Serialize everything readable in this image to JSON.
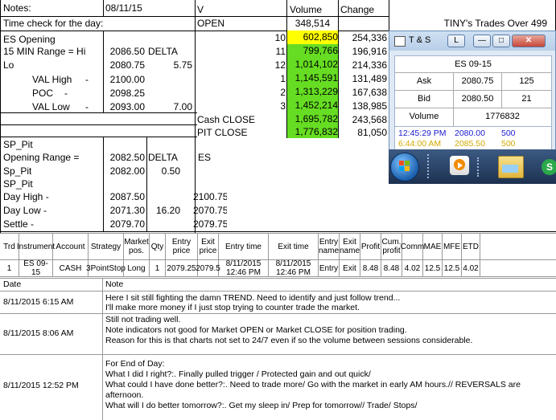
{
  "sheet": {
    "notes_label": "Notes:",
    "date": "08/11/15",
    "time_check": "Time check for the day:",
    "tinys": "TINY's Trades Over 499",
    "es_opening": "ES Opening",
    "range_label": "15 MIN Range = Hi",
    "range_hi": "2086.50",
    "delta_label": "DELTA",
    "lo_label": "Lo",
    "lo_value": "2080.75",
    "delta_value": "5.75",
    "val_high_label": "VAL High",
    "val_high_dash": "-",
    "val_high": "2100.00",
    "poc_label": "POC",
    "poc_dash": "-",
    "poc": "2098.25",
    "val_low_label": "VAL Low",
    "val_low_dash": "-",
    "val_low": "2093.00",
    "val_low_delta": "7.00",
    "sp_pit": "SP_Pit",
    "opening_range_label": "Opening Range =",
    "opening_range": "2082.50",
    "delta2_label": "DELTA",
    "es_label": "ES",
    "sp_pit2_label": "Sp_Pit",
    "sp_pit2_value": "2082.00",
    "sp_pit2_delta": "0.50",
    "sp_pit3": "SP_Pit",
    "day_high_label": "Day High -",
    "day_high": "2087.50",
    "day_high_es": "2100.75",
    "day_low_label": "Day Low -",
    "day_low": "2071.30",
    "day_low_delta": "16.20",
    "day_low_es": "2070.75",
    "settle_label": "Settle -",
    "settle": "2079.70",
    "settle_es": "2079.75"
  },
  "volume_table": {
    "headers": [
      "V",
      "Volume",
      "Change"
    ],
    "open_label": "OPEN",
    "open_volume": "348,514",
    "rows": [
      {
        "label": "10",
        "volume": "602,850",
        "change": "254,336"
      },
      {
        "label": "11",
        "volume": "799,766",
        "change": "196,916"
      },
      {
        "label": "12",
        "volume": "1,014,102",
        "change": "214,336"
      },
      {
        "label": "1",
        "volume": "1,145,591",
        "change": "131,489"
      },
      {
        "label": "2",
        "volume": "1,313,229",
        "change": "167,638"
      },
      {
        "label": "3",
        "volume": "1,452,214",
        "change": "138,985"
      },
      {
        "label": "Cash CLOSE",
        "volume": "1,695,782",
        "change": "243,568"
      },
      {
        "label": "PIT CLOSE",
        "volume": "1,776,832",
        "change": "81,050"
      }
    ]
  },
  "ts_window": {
    "title": "T & S",
    "l_btn": "L",
    "symbol": "ES 09-15",
    "ask_label": "Ask",
    "ask_price": "2080.75",
    "ask_size": "125",
    "bid_label": "Bid",
    "bid_price": "2080.50",
    "bid_size": "21",
    "volume_label": "Volume",
    "volume": "1776832",
    "ticks": [
      {
        "time": "12:45:29 PM",
        "price": "2080.00",
        "size": "500"
      },
      {
        "time": "6:44:00 AM",
        "price": "2085.50",
        "size": "500"
      }
    ]
  },
  "trade_table": {
    "headers": [
      "Trd",
      "Instrument",
      "Account",
      "Strategy",
      "Market pos.",
      "Qty",
      "Entry price",
      "Exit price",
      "Entry time",
      "Exit time",
      "Entry name",
      "Exit name",
      "Profit",
      "Cum. profit",
      "Comm",
      "MAE",
      "MFE",
      "ETD"
    ],
    "row": [
      "1",
      "ES 09-15",
      "CASH",
      "3PointStop",
      "Long",
      "1",
      "2079.25",
      "2079.5",
      "8/11/2015 12:46 PM",
      "8/11/2015 12:46 PM",
      "Entry",
      "Exit",
      "8.48",
      "8.48",
      "4.02",
      "12.5",
      "12.5",
      "4.02"
    ]
  },
  "notes": {
    "header_date": "Date",
    "header_note": "Note",
    "entries": [
      {
        "date": "8/11/2015 6:15 AM",
        "lines": [
          "Here I sit still fighting the damn TREND.  Need to identify and just follow trend...",
          "I'll make more money if I just stop trying to counter trade the market."
        ]
      },
      {
        "date": "8/11/2015 8:06 AM",
        "lines": [
          "Still not trading well.",
          "Note indicators not good for Market OPEN or Market CLOSE for position trading.",
          "Reason for this is that charts not set to 24/7 even if so the volume between sessions considerable."
        ]
      },
      {
        "date": "8/11/2015 12:52 PM",
        "lines": [
          "For End of Day:",
          "What I did I right?:.  Finally pulled trigger / Protected gain and out quick/",
          "What could I have done better?:.  Need to trade more/ Go with the market in early AM hours.// REVERSALS are",
          "afternoon.",
          "What will I do better tomorrow?:.  Get my sleep in/ Prep for tomorrow// Trade/ Stops/"
        ]
      }
    ]
  }
}
